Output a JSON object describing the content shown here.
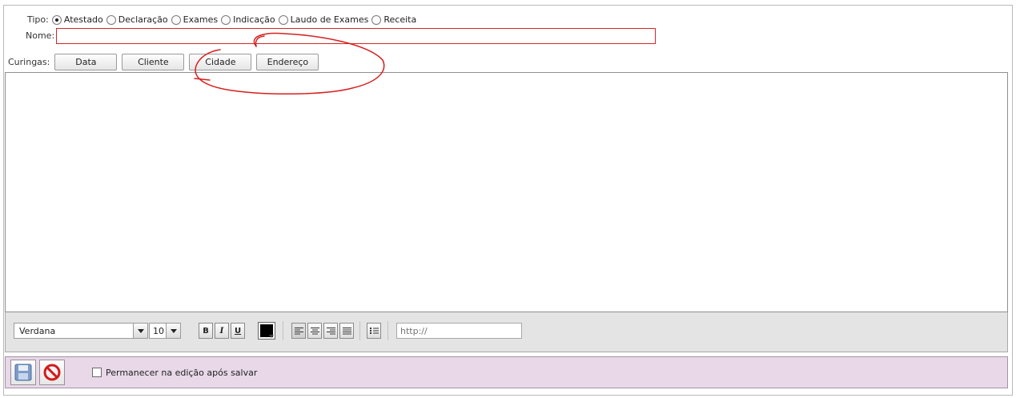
{
  "tipo": {
    "label": "Tipo:",
    "options": [
      "Atestado",
      "Declaração",
      "Exames",
      "Indicação",
      "Laudo de Exames",
      "Receita"
    ],
    "selected": "Atestado"
  },
  "nome": {
    "label": "Nome:",
    "value": ""
  },
  "curingas": {
    "label": "Curingas:",
    "buttons": [
      "Data",
      "Cliente",
      "Cidade",
      "Endereço"
    ]
  },
  "editor": {
    "content": ""
  },
  "toolbar": {
    "font": "Verdana",
    "size": "10",
    "bold": "B",
    "italic": "I",
    "underline": "U",
    "text_color": "#000000",
    "url_placeholder": "http://"
  },
  "footer": {
    "save_icon": "floppy-disk-icon",
    "cancel_icon": "no-entry-icon",
    "keep_editing_label": "Permanecer na edição após salvar",
    "keep_editing_checked": false
  },
  "annotation": {
    "color": "#d81f1f"
  }
}
